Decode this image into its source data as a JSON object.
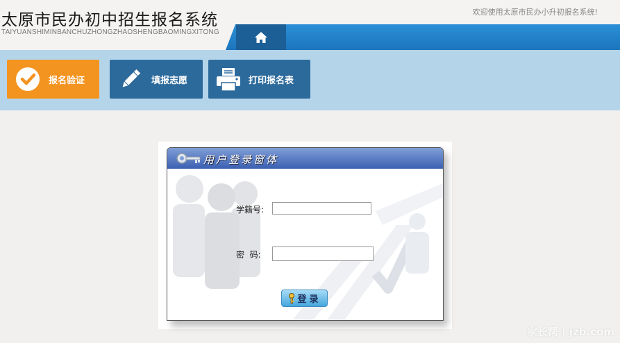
{
  "header": {
    "title": "太原市民办初中招生报名系统",
    "subtitle": "TAIYUANSHIMINBANCHUZHONGZHAOSHENGBAOMINGXITONG",
    "welcome": "欢迎使用太原市民办小升初报名系统!",
    "home_icon": "home-icon"
  },
  "nav": {
    "items": [
      {
        "label": "报名验证",
        "icon": "checkmark-circle-icon",
        "active": true
      },
      {
        "label": "填报志愿",
        "icon": "pencil-icon",
        "active": false
      },
      {
        "label": "打印报名表",
        "icon": "printer-icon",
        "active": false
      }
    ]
  },
  "login": {
    "title": "用户登录窗体",
    "student_id_label": "学籍号:",
    "student_id_value": "",
    "password_label": "密  码:",
    "password_value": "",
    "submit_label": "登录"
  },
  "watermark": "家长帮 | jzb.com",
  "colors": {
    "accent_orange": "#f49420",
    "nav_blue": "#2d6a9c",
    "nav_band": "#b4d4ea",
    "top_bar": "#1f80c5"
  }
}
